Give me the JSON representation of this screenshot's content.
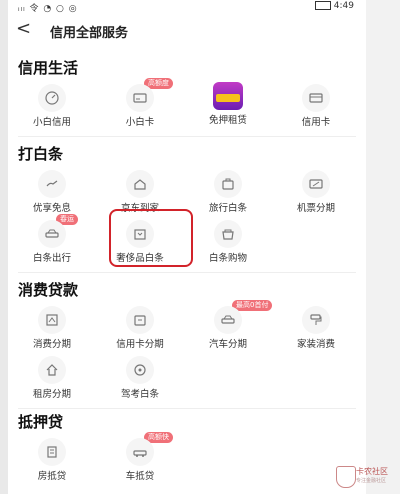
{
  "statusbar": {
    "signal": "ᵢₗₗ 令 ◔ ○ ◎",
    "time": "4:49"
  },
  "header": {
    "back_icon": "chevron-left-icon",
    "back_glyph": "<",
    "title": "信用全部服务"
  },
  "sections": [
    {
      "title": "信用生活",
      "items": [
        {
          "label": "小白信用",
          "icon": "gauge-icon",
          "badge": ""
        },
        {
          "label": "小白卡",
          "icon": "card-icon",
          "badge": "高额度"
        },
        {
          "label": "免押租赁",
          "icon": "promo-icon",
          "badge": ""
        },
        {
          "label": "信用卡",
          "icon": "credit-card-icon",
          "badge": ""
        }
      ]
    },
    {
      "title": "打白条",
      "items": [
        {
          "label": "优享免息",
          "icon": "hand-icon",
          "badge": ""
        },
        {
          "label": "京东到家",
          "icon": "house-icon",
          "badge": ""
        },
        {
          "label": "旅行白条",
          "icon": "suitcase-icon",
          "badge": ""
        },
        {
          "label": "机票分期",
          "icon": "plane-ticket-icon",
          "badge": ""
        },
        {
          "label": "白条出行",
          "icon": "car-icon",
          "badge": "春运"
        },
        {
          "label": "奢侈品白条",
          "icon": "gift-bag-icon",
          "badge": ""
        },
        {
          "label": "白条购物",
          "icon": "shopping-icon",
          "badge": ""
        }
      ]
    },
    {
      "title": "消费贷款",
      "items": [
        {
          "label": "消费分期",
          "icon": "installment-icon",
          "badge": ""
        },
        {
          "label": "信用卡分期",
          "icon": "card-installment-icon",
          "badge": ""
        },
        {
          "label": "汽车分期",
          "icon": "car-icon",
          "badge": "最高0首付"
        },
        {
          "label": "家装消费",
          "icon": "paint-roller-icon",
          "badge": ""
        },
        {
          "label": "租房分期",
          "icon": "home-icon",
          "badge": ""
        },
        {
          "label": "驾考白条",
          "icon": "steering-icon",
          "badge": ""
        }
      ]
    },
    {
      "title": "抵押贷",
      "items": [
        {
          "label": "房抵贷",
          "icon": "building-icon",
          "badge": ""
        },
        {
          "label": "车抵贷",
          "icon": "car-loan-icon",
          "badge": "高额快"
        }
      ]
    }
  ],
  "watermark": {
    "text": "卡农社区",
    "sub": "专注金融社区"
  }
}
